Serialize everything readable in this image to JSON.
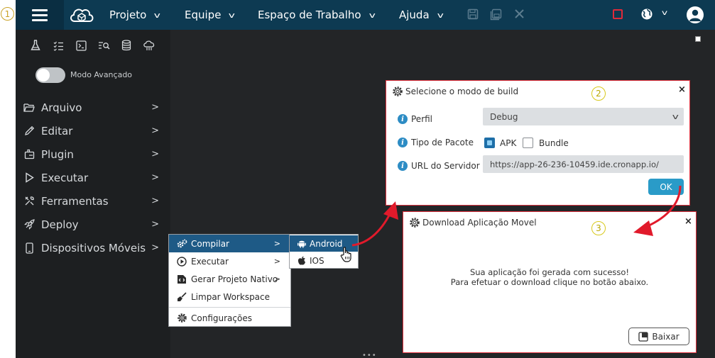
{
  "step_badges": [
    "1",
    "2",
    "3"
  ],
  "topbar": {
    "menus": [
      "Projeto",
      "Equipe",
      "Espaço de Trabalho",
      "Ajuda"
    ],
    "icons": [
      "hamburger-icon",
      "cloud-logo-icon",
      "save-icon",
      "save-all-icon",
      "close-icon",
      "stop-icon",
      "globe-icon",
      "user-icon"
    ]
  },
  "sidebar": {
    "tool_icons": [
      "flask-icon",
      "checklist-icon",
      "terminal-icon",
      "search-list-icon",
      "database-icon",
      "cloud-sync-icon"
    ],
    "advanced_mode_label": "Modo Avançado",
    "advanced_mode_on": false,
    "items": [
      {
        "label": "Arquivo",
        "icon": "folder-icon"
      },
      {
        "label": "Editar",
        "icon": "pencil-icon"
      },
      {
        "label": "Plugin",
        "icon": "plugin-icon"
      },
      {
        "label": "Executar",
        "icon": "play-icon"
      },
      {
        "label": "Ferramentas",
        "icon": "tools-icon"
      },
      {
        "label": "Deploy",
        "icon": "rocket-icon"
      },
      {
        "label": "Dispositivos Móveis",
        "icon": "mobile-icon"
      }
    ]
  },
  "context_menu": {
    "items": [
      {
        "label": "Compilar",
        "icon": "gears-icon",
        "has_submenu": true,
        "active": true
      },
      {
        "label": "Executar",
        "icon": "play-circle-icon",
        "has_submenu": true
      },
      {
        "label": "Gerar Projeto Nativo",
        "icon": "code-icon",
        "has_submenu": true
      },
      {
        "label": "Limpar Workspace",
        "icon": "broom-icon",
        "has_submenu": false
      },
      {
        "label": "Configurações",
        "icon": "gear-icon",
        "has_submenu": false
      }
    ],
    "submenu": [
      {
        "label": "Android",
        "icon": "android-icon",
        "active": true
      },
      {
        "label": "IOS",
        "icon": "apple-icon"
      }
    ]
  },
  "build_dialog": {
    "title": "Selecione o modo de build",
    "profile_label": "Perfil",
    "profile_value": "Debug",
    "package_label": "Tipo de Pacote",
    "package_options": [
      {
        "label": "APK",
        "checked": true
      },
      {
        "label": "Bundle",
        "checked": false
      }
    ],
    "server_label": "URL do Servidor",
    "server_value": "https://app-26-236-10459.ide.cronapp.io/",
    "ok_label": "OK"
  },
  "download_dialog": {
    "title": "Download Aplicação Movel",
    "message_line1": "Sua aplicação foi gerada com sucesso!",
    "message_line2": "Para efetuar o download clique no botão abaixo.",
    "download_label": "Baixar"
  },
  "colors": {
    "topbar": "#0d3a52",
    "sidebar": "#1d1f21",
    "workspace": "#232527",
    "menu_active": "#1e5a86",
    "highlight_border": "#e2323f",
    "ok_button": "#2a9bc8"
  }
}
